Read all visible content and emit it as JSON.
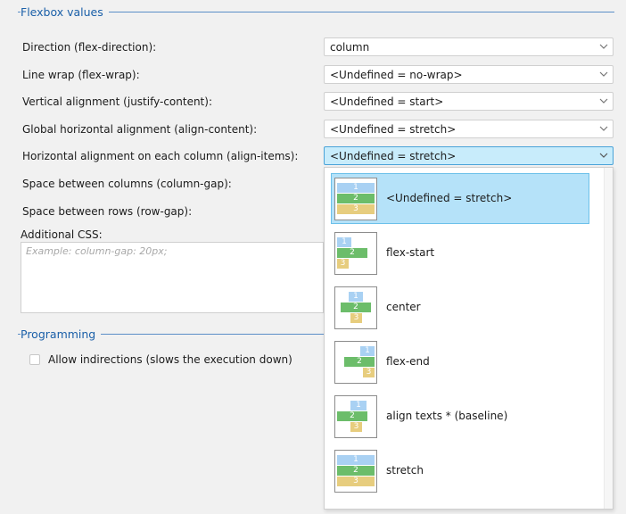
{
  "flexbox_section": {
    "title": "Flexbox values",
    "fields": [
      {
        "label": "Direction (flex-direction):",
        "value": "column"
      },
      {
        "label": "Line wrap (flex-wrap):",
        "value": "<Undefined = no-wrap>"
      },
      {
        "label": "Vertical alignment (justify-content):",
        "value": "<Undefined = start>"
      },
      {
        "label": "Global horizontal alignment (align-content):",
        "value": "<Undefined = stretch>"
      },
      {
        "label": "Horizontal alignment on each column (align-items):",
        "value": "<Undefined = stretch>"
      }
    ],
    "column_gap_label": "Space between columns (column-gap):",
    "row_gap_label": "Space between rows (row-gap):",
    "additional_css_label": "Additional CSS:",
    "additional_css_placeholder": "Example: column-gap: 20px;"
  },
  "programming_section": {
    "title": "Programming",
    "allow_indirections_label": "Allow indirections (slows the execution down)",
    "allow_indirections_checked": false
  },
  "dropdown": {
    "selected_index": 0,
    "options": [
      {
        "label": "<Undefined = stretch>",
        "icon": "align-stretch-icon"
      },
      {
        "label": "flex-start",
        "icon": "align-flex-start-icon"
      },
      {
        "label": "center",
        "icon": "align-center-icon"
      },
      {
        "label": "flex-end",
        "icon": "align-flex-end-icon"
      },
      {
        "label": "align texts * (baseline)",
        "icon": "align-baseline-icon"
      },
      {
        "label": "stretch",
        "icon": "align-stretch-icon"
      }
    ],
    "preview_numbers": [
      "1",
      "2",
      "3"
    ]
  },
  "colors": {
    "section_title": "#1a5fa8",
    "selected_background": "#b5e2f9",
    "item1": "#a9d1f3",
    "item2": "#6cbd6a",
    "item3": "#e7cd7e"
  }
}
